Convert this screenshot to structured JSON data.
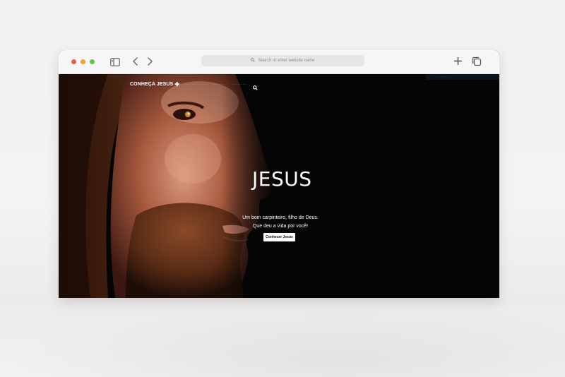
{
  "browser": {
    "address_placeholder": "Search or enter website name"
  },
  "site": {
    "brand": "CONHEÇA JESUS",
    "brand_symbol": "✚",
    "nav_items": [
      "····· ··········· ·",
      "········· ·",
      "············"
    ],
    "corner_badge": "·············"
  },
  "hero": {
    "title": "JESUS",
    "subtitle_line1": "Um bom carpinteiro, filho de Deus.",
    "subtitle_line2": "Que deu a vida por você!",
    "cta_label": "Conhecer Jesus"
  },
  "icons": {
    "search": "search-icon",
    "sidebar": "sidebar-icon",
    "back": "chevron-left-icon",
    "forward": "chevron-right-icon",
    "new_tab": "plus-icon",
    "tabs": "tabs-overview-icon"
  },
  "colors": {
    "close": "#ee5b55",
    "minimize": "#f0a72f",
    "maximize": "#5dc247",
    "hero_bg": "#050505"
  }
}
